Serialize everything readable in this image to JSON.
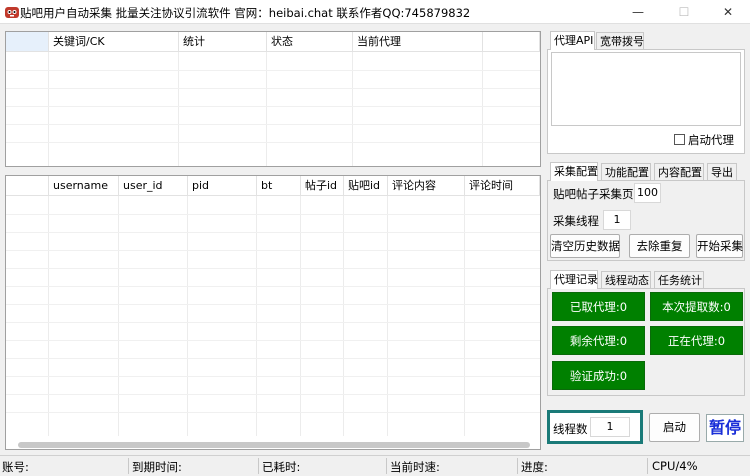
{
  "window": {
    "title": "贴吧用户自动采集 批量关注协议引流软件 官网：heibai.chat 联系作者QQ:745879832",
    "minimize": "—",
    "maximize": "☐",
    "close": "✕"
  },
  "top_grid": {
    "columns": [
      "",
      "关键词/CK",
      "统计",
      "状态",
      "当前代理",
      ""
    ]
  },
  "bottom_grid": {
    "columns": [
      "",
      "username",
      "user_id",
      "pid",
      "bt",
      "帖子id",
      "贴吧id",
      "评论内容",
      "评论时间"
    ]
  },
  "proxy_tabs": [
    "代理API",
    "宽带拨号"
  ],
  "proxy": {
    "auto_proxy_label": "启动代理"
  },
  "config_tabs": [
    "采集配置",
    "功能配置",
    "内容配置",
    "导出"
  ],
  "config": {
    "pages_label": "贴吧帖子采集页",
    "pages_value": "100",
    "threads_label": "采集线程",
    "threads_value": "1",
    "clear_history": "清空历史数据",
    "dedupe": "去除重复",
    "start_collect": "开始采集"
  },
  "stats_tabs": [
    "代理记录",
    "线程动态",
    "任务统计"
  ],
  "stats": {
    "fetched": "已取代理:0",
    "this_fetch": "本次提取数:0",
    "remaining": "剩余代理:0",
    "in_use": "正在代理:0",
    "verified": "验证成功:0"
  },
  "control": {
    "thread_label": "线程数",
    "thread_value": "1",
    "start": "启动",
    "pause": "暂停"
  },
  "status_bar": {
    "account": "账号:",
    "expire": "到期时间:",
    "elapsed": "已耗时:",
    "speed": "当前时速:",
    "progress": "进度:",
    "cpu": "CPU/4%"
  },
  "colors": {
    "green_button": "#008000",
    "thread_border": "#1a7a78",
    "pause_text": "#1a2fd8"
  }
}
